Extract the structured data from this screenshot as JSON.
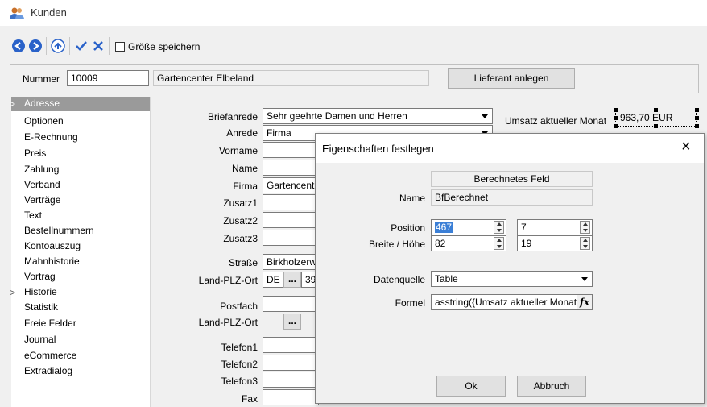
{
  "window": {
    "title": "Kunden"
  },
  "toolbar": {
    "size_save_label": "Größe speichern"
  },
  "header": {
    "number_label": "Nummer",
    "number_value": "10009",
    "company_display": "Gartencenter Elbeland",
    "supplier_button": "Lieferant anlegen"
  },
  "nav": {
    "items": [
      "Adresse",
      "Optionen",
      "E-Rechnung",
      "Preis",
      "Zahlung",
      "Verband",
      "Verträge",
      "Text",
      "Bestellnummern",
      "Kontoauszug",
      "Mahnhistorie",
      "Vortrag",
      "Historie",
      "Statistik",
      "Freie Felder",
      "Journal",
      "eCommerce",
      "Extradialog"
    ]
  },
  "form": {
    "labels": {
      "briefanrede": "Briefanrede",
      "anrede": "Anrede",
      "vorname": "Vorname",
      "name": "Name",
      "firma": "Firma",
      "zusatz1": "Zusatz1",
      "zusatz2": "Zusatz2",
      "zusatz3": "Zusatz3",
      "strasse": "Straße",
      "land_plz_ort": "Land-PLZ-Ort",
      "postfach": "Postfach",
      "land_plz_ort2": "Land-PLZ-Ort",
      "telefon1": "Telefon1",
      "telefon2": "Telefon2",
      "telefon3": "Telefon3",
      "fax": "Fax"
    },
    "values": {
      "briefanrede": "Sehr geehrte Damen und Herren",
      "anrede": "Firma",
      "firma": "Gartencent",
      "strasse": "Birkholzerw",
      "land": "DE",
      "dots": "...",
      "plz": "39",
      "dots2": "..."
    },
    "umsatz_label": "Umsatz aktueller Monat",
    "umsatz_value": "963,70 EUR"
  },
  "dialog": {
    "title": "Eigenschaften festlegen",
    "close": "×",
    "section_label": "Berechnetes Feld",
    "name_label": "Name",
    "name_value": "BfBerechnet",
    "position_label": "Position",
    "position_x": "467",
    "position_y": "7",
    "size_label": "Breite / Höhe",
    "width": "82",
    "height": "19",
    "datasource_label": "Datenquelle",
    "datasource_value": "Table",
    "formula_label": "Formel",
    "formula_value": "asstring({Umsatz aktueller Monat",
    "fx": "fx",
    "ok": "Ok",
    "cancel": "Abbruch"
  }
}
